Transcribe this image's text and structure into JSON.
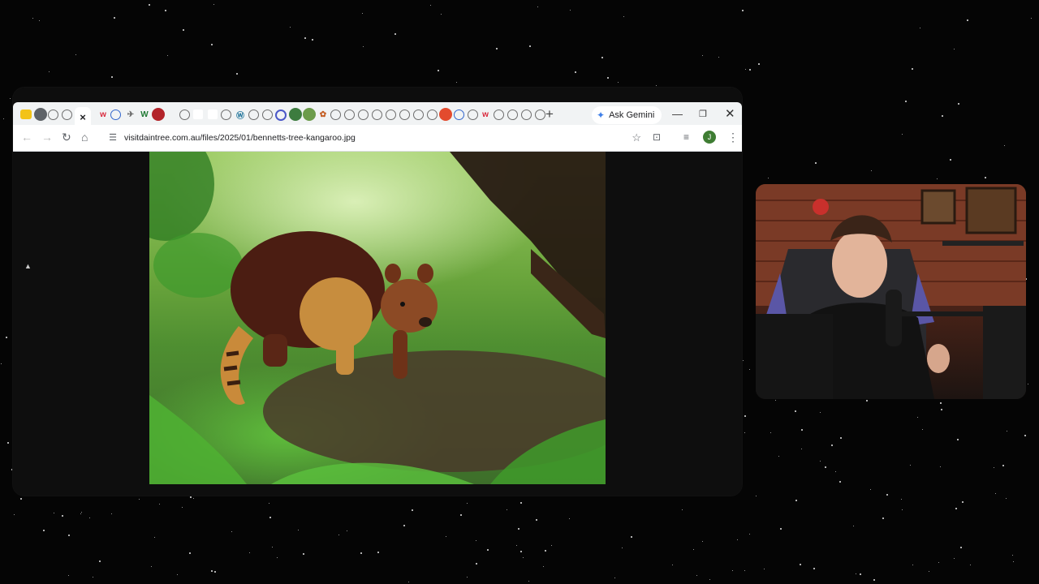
{
  "browser": {
    "url": "visitdaintree.com.au/files/2025/01/bennetts-tree-kangaroo.jpg",
    "gemini_label": "Ask Gemini",
    "new_tab_label": "+",
    "close_tab_label": "×",
    "profile_initial": "J",
    "image_description_name": "bennetts-tree-kangaroo"
  },
  "icons": {
    "back": "back-arrow-icon",
    "forward": "forward-arrow-icon",
    "reload": "reload-icon",
    "home": "home-icon",
    "site_info": "tune-icon",
    "bookmark": "star-icon",
    "lens": "search-lens-icon",
    "reading_list": "reading-list-icon",
    "menu": "kebab-menu-icon"
  },
  "colors": {
    "accent": "#3f7fe8",
    "profile": "#3f7d33"
  }
}
